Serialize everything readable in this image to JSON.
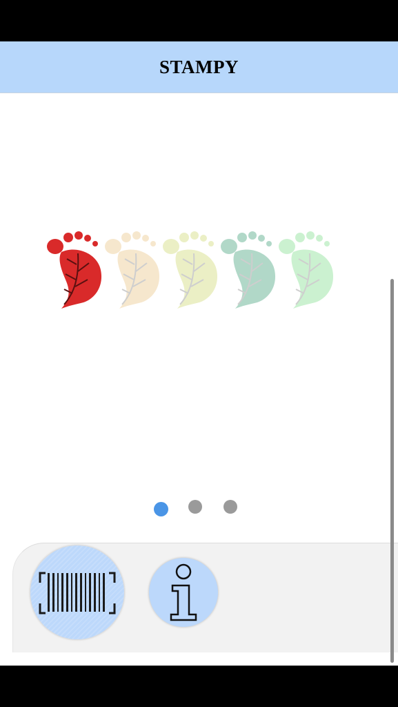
{
  "header": {
    "title": "STAMPY"
  },
  "stamps": {
    "total": 5,
    "collected": 1,
    "colors": [
      "#d92a2a",
      "#f6e5c8",
      "#e9eebf",
      "#a9d4c3",
      "#c6f0cb"
    ]
  },
  "pager": {
    "pages": 3,
    "current": 1
  },
  "bottom_nav": {
    "scan_icon": "barcode-scan-icon",
    "info_icon": "info-icon"
  }
}
